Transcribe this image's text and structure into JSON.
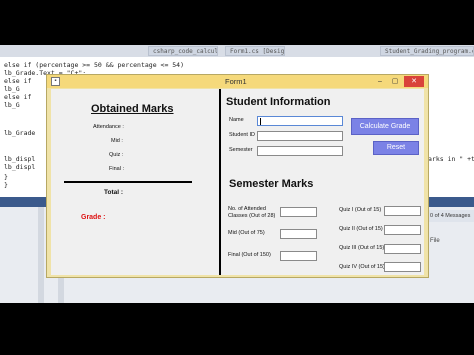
{
  "ide": {
    "tabs": [
      "csharp_code_calculation.cs",
      "Form1.cs [Design]",
      "Student_Grading_program.cs"
    ],
    "code_lines": [
      "else if (percentage >= 50 && percentage <= 54)",
      "  lb_Grade.Text = \"C+\";",
      "else if",
      "  lb_G",
      "else if",
      "  lb_G",
      "",
      "lb_Grade",
      "",
      "lb_displ",
      "lb_displ",
      "}",
      "}"
    ],
    "right_code": "arks in \" +th",
    "panel_right": "0 of 4 Messages",
    "file_label": "File"
  },
  "window": {
    "title": "Form1",
    "icon": "form-app-icon",
    "minimize": "–",
    "maximize": "▢",
    "close": "✕"
  },
  "obtained": {
    "heading": "Obtained Marks",
    "attendance": "Attendance :",
    "mid": "Mid :",
    "quiz": "Quiz :",
    "final": "Final :",
    "total": "Total :",
    "grade": "Grade :"
  },
  "student": {
    "heading": "Student Information",
    "name_label": "Name",
    "id_label": "Student ID",
    "semester_label": "Semester",
    "calculate_button": "Calculate Grade",
    "reset_button": "Reset"
  },
  "semester": {
    "heading": "Semester Marks",
    "classes_label": "No. of Attended Classes (Out of 28)",
    "mid_label": "Mid (Out of 75)",
    "final_label": "Final (Out of 150)",
    "quiz1_label": "Quiz I (Out of 15)",
    "quiz2_label": "Quiz II (Out of 15)",
    "quiz3_label": "Quiz III (Out of 15)",
    "quiz4_label": "Quiz IV (Out of 15)"
  },
  "colors": {
    "form_border": "#f0e3a8",
    "titlebar": "#f5d97b",
    "button": "#7b82e6",
    "grade_label": "#dd1111"
  }
}
